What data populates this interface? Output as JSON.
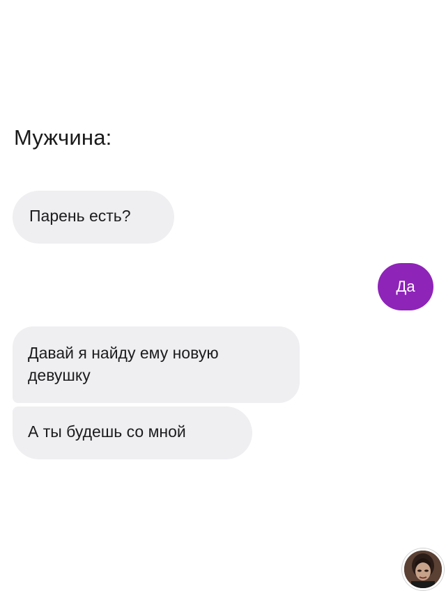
{
  "chat": {
    "sender_label": "Мужчина:",
    "messages": [
      {
        "direction": "incoming",
        "text": "Парень есть?"
      },
      {
        "direction": "outgoing",
        "text": "Да"
      },
      {
        "direction": "incoming",
        "text": "Давай я найду ему новую девушку"
      },
      {
        "direction": "incoming",
        "text": "А ты будешь со мной"
      }
    ]
  },
  "colors": {
    "incoming_bubble": "#efeff2",
    "outgoing_bubble": "#8e24b8",
    "background": "#ffffff"
  },
  "icons": {
    "corner_avatar": "avatar-watermark-icon"
  }
}
